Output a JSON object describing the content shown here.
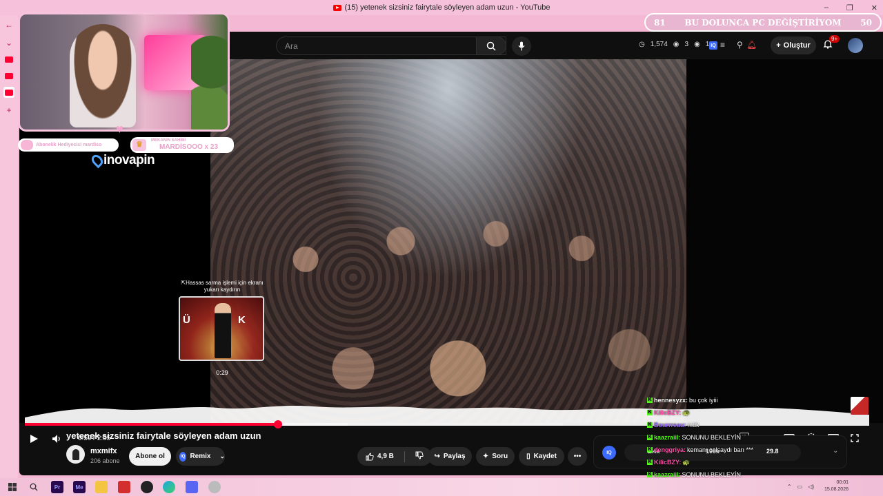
{
  "window": {
    "title": "(15) yetenek sizsiniz fairytale söyleyen adam uzun - YouTube",
    "controls": [
      "–",
      "❐",
      "✕"
    ]
  },
  "sidebar": {
    "items": [
      {
        "icon": "arrow-left-icon",
        "glyph": "←"
      },
      {
        "icon": "chevron-down-icon",
        "glyph": "⌄"
      },
      {
        "icon": "youtube-tab-icon",
        "glyph": ""
      },
      {
        "icon": "youtube-tab-icon",
        "glyph": ""
      },
      {
        "icon": "youtube-tab-icon",
        "glyph": ""
      },
      {
        "icon": "plus-icon",
        "glyph": "+"
      }
    ]
  },
  "header": {
    "logo_partial": "r",
    "search_placeholder": "Ara",
    "stats": {
      "time": "1,574",
      "views_a": "3",
      "views_b": "139"
    },
    "create_label": "Oluştur",
    "notif_badge": "9+"
  },
  "player": {
    "preview_tip": "⇱Hassas sarma işlemi için ekranı yukarı kaydırın",
    "preview_letters": [
      "Ü",
      "K"
    ],
    "preview_time": "0:29",
    "current_time": "0:59",
    "duration": "2:05",
    "time_separator": " / ",
    "progress_played": 0.47,
    "progress_loaded": 0.6,
    "preview_position": 0.234
  },
  "video": {
    "title": "yetenek sizsiniz fairytale söyleyen adam uzun",
    "channel": "mxmifx",
    "subscribers": "206 abone",
    "subscribe_label": "Abone ol",
    "remix_label": "Remix",
    "likes": "4,9 B",
    "share_label": "Paylaş",
    "ask_label": "Soru",
    "save_label": "Kaydet"
  },
  "iq_extension": {
    "label": "IQ",
    "values": [
      "1.4x",
      "100x",
      "29.8"
    ]
  },
  "overlay": {
    "goal_left": "81",
    "goal_text": "BU DOLUNCA PC DEĞİŞTİRİYOM",
    "goal_right": "50",
    "badge_left": "Abonelik Hediyecisi mardiso",
    "badge_right_line1": "MEKANIN SAHİBİ",
    "badge_right_line2": "MARDİSOOO x 23",
    "sponsor": "inovapin"
  },
  "chat": [
    {
      "user": "hennesyzx:",
      "msg": "bu çok iyiii",
      "color": "#ffffff"
    },
    {
      "user": "KilicBZY:",
      "msg": "🐢",
      "color": "#ff4fa8"
    },
    {
      "user": "Bourrreau:",
      "msg": "mük",
      "color": "#9b6bff"
    },
    {
      "user": "kaazraiil:",
      "msg": "SONUNU BEKLEYİN",
      "color": "#53fc18"
    },
    {
      "user": "denggriya:",
      "msg": "kemanı çalsaydı barı ***",
      "color": "#ff4fa8"
    },
    {
      "user": "KilicBZY:",
      "msg": "🐢",
      "color": "#ff4fa8"
    },
    {
      "user": "kaazraiil:",
      "msg": "SONUNU BEKLEYİN",
      "color": "#53fc18"
    }
  ],
  "taskbar": {
    "time": "00:01",
    "date": "15.08.2026",
    "apps": [
      "start",
      "search",
      "Pr",
      "Me",
      "files",
      "app-red",
      "obs",
      "edge",
      "discord",
      "app-gray"
    ]
  }
}
